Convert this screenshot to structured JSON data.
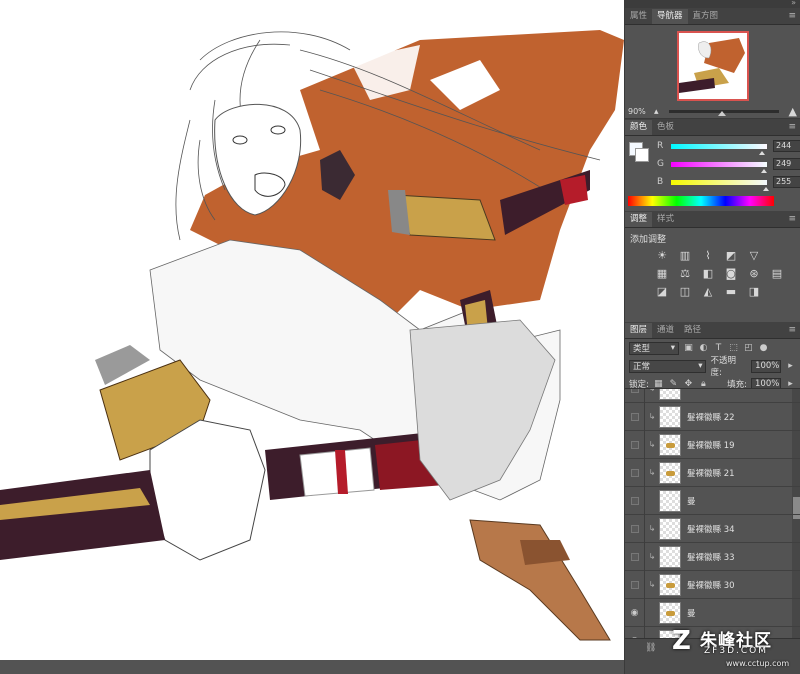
{
  "panel": {
    "top_menu_glyph": "»",
    "nav_tabs": [
      "属性",
      "导航器",
      "直方图"
    ],
    "nav_active": 1,
    "zoom": "90%",
    "color_tabs": [
      "颜色",
      "色板"
    ],
    "color_active": 0,
    "rgb": {
      "r_label": "R",
      "r": "244",
      "g_label": "G",
      "g": "249",
      "b_label": "B",
      "b": "255"
    },
    "adjust_tabs": [
      "调整",
      "样式"
    ],
    "adjust_active": 0,
    "adjust_title": "添加调整",
    "adjust_icons": [
      "brightness-icon",
      "levels-icon",
      "curves-icon",
      "exposure-icon",
      "vibrance-icon",
      "hue-saturation-icon",
      "color-balance-icon",
      "black-white-icon",
      "photo-filter-icon",
      "channel-mixer-icon",
      "color-lookup-icon",
      "invert-icon",
      "posterize-icon",
      "threshold-icon",
      "gradient-map-icon",
      "selective-color-icon"
    ],
    "layer_tabs": [
      "图层",
      "通道",
      "路径"
    ],
    "layer_active": 0,
    "filter_kind": "类型",
    "blend_mode": "正常",
    "opacity_label": "不透明度:",
    "opacity": "100%",
    "lock_label": "锁定:",
    "fill_label": "填充:",
    "fill": "100%"
  },
  "layers": [
    {
      "name": "",
      "clip": true,
      "visible": false,
      "thumb": "transparent"
    },
    {
      "name": "髮裸徽縣 22",
      "clip": true,
      "visible": false,
      "thumb": "transparent"
    },
    {
      "name": "髮裸徽縣 19",
      "clip": true,
      "visible": false,
      "thumb": "spec"
    },
    {
      "name": "髮裸徽縣 21",
      "clip": true,
      "visible": false,
      "thumb": "spec"
    },
    {
      "name": "曼",
      "clip": false,
      "visible": false,
      "thumb": "transparent"
    },
    {
      "name": "髮裸徽縣 34",
      "clip": true,
      "visible": false,
      "thumb": "transparent"
    },
    {
      "name": "髮裸徽縣 33",
      "clip": true,
      "visible": false,
      "thumb": "transparent"
    },
    {
      "name": "髮裸徽縣 30",
      "clip": true,
      "visible": false,
      "thumb": "spec"
    },
    {
      "name": "曼",
      "clip": false,
      "visible": true,
      "thumb": "spec"
    },
    {
      "name": "",
      "clip": false,
      "visible": true,
      "thumb": "spec"
    }
  ],
  "colors": {
    "canvas_bg": "#ffffff",
    "accent_orange": "#c0622f",
    "panel_bg": "#535353",
    "navigator_frame": "#d9534f"
  },
  "watermark": {
    "logo": "Z",
    "title": "朱峰社区",
    "subtitle": "ZF3D.COM",
    "url": "www.cctup.com"
  }
}
